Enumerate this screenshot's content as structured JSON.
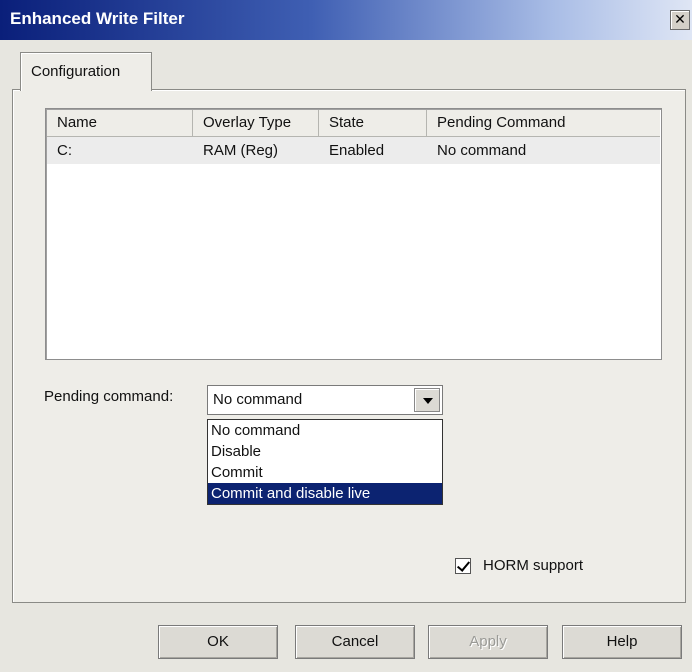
{
  "window": {
    "title": "Enhanced Write Filter",
    "close_label": "✕"
  },
  "tabs": [
    {
      "label": "Configuration"
    }
  ],
  "list": {
    "columns": [
      "Name",
      "Overlay Type",
      "State",
      "Pending Command"
    ],
    "rows": [
      {
        "name": "C:",
        "overlay_type": "RAM (Reg)",
        "state": "Enabled",
        "pending_command": "No command"
      }
    ]
  },
  "pending_command": {
    "label": "Pending command:",
    "value": "No command",
    "options": [
      "No command",
      "Disable",
      "Commit",
      "Commit and disable live"
    ],
    "highlighted_option": "Commit and disable live"
  },
  "horm": {
    "label": "HORM support",
    "checked": true
  },
  "buttons": {
    "ok": "OK",
    "cancel": "Cancel",
    "apply": "Apply",
    "help": "Help"
  },
  "colors": {
    "title_bar": "#0a1f7a",
    "selection": "#0c2371"
  }
}
